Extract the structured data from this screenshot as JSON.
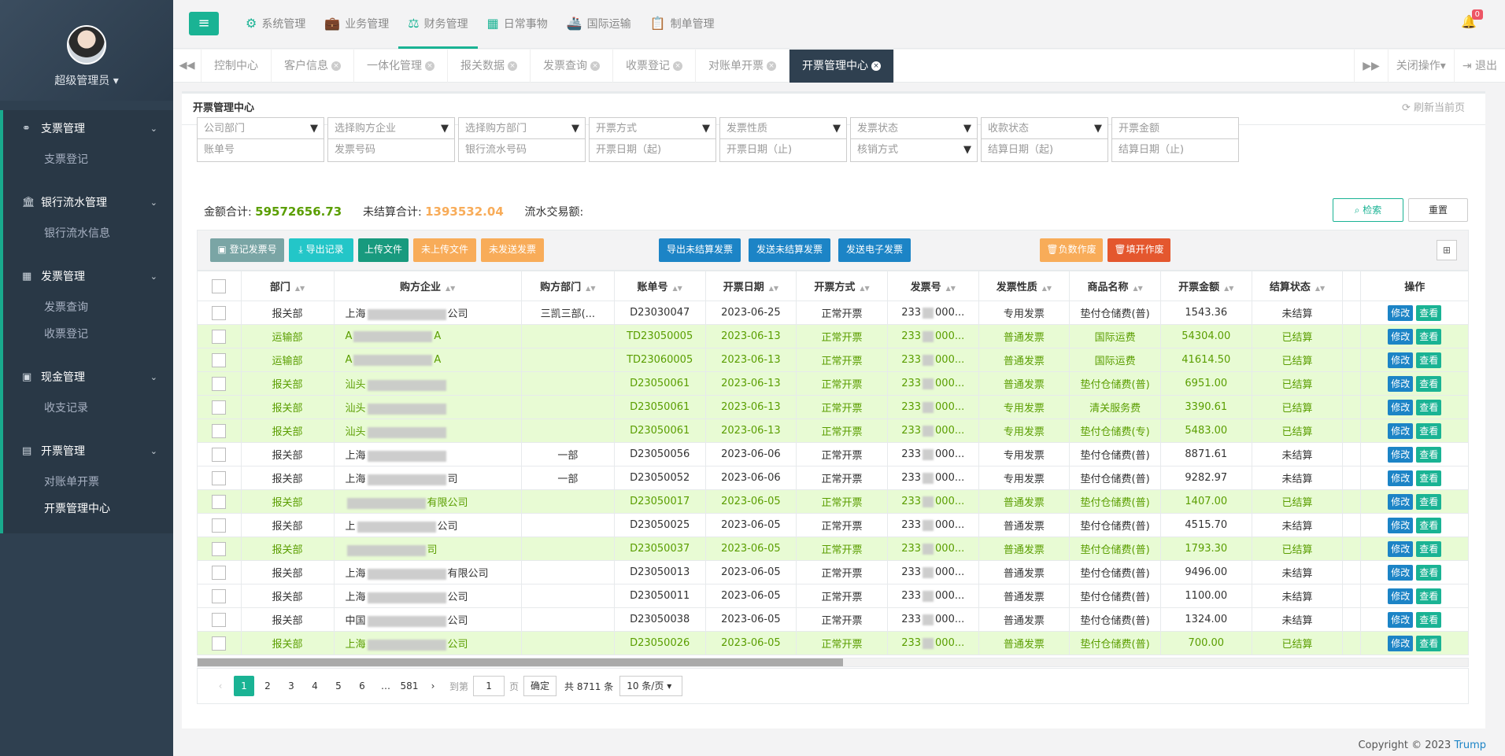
{
  "sidebar": {
    "user": "超级管理员",
    "groups": [
      {
        "label": "支票管理",
        "icon": "link-icon",
        "items": [
          "支票登记"
        ]
      },
      {
        "label": "银行流水管理",
        "icon": "bank-icon",
        "items": [
          "银行流水信息"
        ]
      },
      {
        "label": "发票管理",
        "icon": "grid-icon",
        "items": [
          "发票查询",
          "收票登记"
        ]
      },
      {
        "label": "现金管理",
        "icon": "money-icon",
        "items": [
          "收支记录"
        ]
      },
      {
        "label": "开票管理",
        "icon": "calendar-icon",
        "items": [
          "对账单开票",
          "开票管理中心"
        ]
      }
    ]
  },
  "topnav": [
    "系统管理",
    "业务管理",
    "财务管理",
    "日常事物",
    "国际运输",
    "制单管理"
  ],
  "topnav_active": "财务管理",
  "notification_count": "0",
  "tabs": [
    "控制中心",
    "客户信息",
    "一体化管理",
    "报关数据",
    "发票查询",
    "收票登记",
    "对账单开票",
    "开票管理中心"
  ],
  "tabbar_right": {
    "close_ops": "关闭操作",
    "logout": "退出"
  },
  "panel": {
    "title": "开票管理中心",
    "refresh": "刷新当前页"
  },
  "filters_row1": [
    "公司部门",
    "选择购方企业",
    "选择购方部门",
    "开票方式",
    "发票性质",
    "发票状态",
    "收款状态",
    "开票金额"
  ],
  "filters_row2": [
    "账单号",
    "发票号码",
    "银行流水号码",
    "开票日期（起)",
    "开票日期（止)",
    "核销方式",
    "结算日期（起)",
    "结算日期（止)"
  ],
  "sums": {
    "total_label": "金额合计:",
    "total_value": "59572656.73",
    "unsettled_label": "未结算合计:",
    "unsettled_value": "1393532.04",
    "flow_label": "流水交易额:"
  },
  "search_btn": "检索",
  "reset_btn": "重置",
  "toolbar": {
    "register": "登记发票号",
    "export_record": "导出记录",
    "upload": "上传文件",
    "not_uploaded": "未上传文件",
    "not_sent": "未发送发票",
    "export_unsettled": "导出未结算发票",
    "send_unsettled": "发送未结算发票",
    "send_e": "发送电子发票",
    "negative_void": "负数作废",
    "issue_void": "填开作废"
  },
  "columns": [
    "部门",
    "购方企业",
    "购方部门",
    "账单号",
    "开票日期",
    "开票方式",
    "发票号",
    "发票性质",
    "商品名称",
    "开票金额",
    "结算状态",
    "操作"
  ],
  "rows": [
    {
      "dept": "报关部",
      "company": "上海",
      "company_tail": "公司",
      "buyer_dept": "三凯三部(...",
      "bill": "D23030047",
      "date": "2023-06-25",
      "method": "正常开票",
      "invoice": "233",
      "invoice_tail": "000...",
      "nature": "专用发票",
      "goods": "垫付仓储费(普)",
      "amount": "1543.36",
      "status": "未结算"
    },
    {
      "dept": "运输部",
      "company": "A",
      "company_tail": "A",
      "buyer_dept": "",
      "bill": "TD23050005",
      "date": "2023-06-13",
      "method": "正常开票",
      "invoice": "233",
      "invoice_tail": "000...",
      "nature": "普通发票",
      "goods": "国际运费",
      "amount": "54304.00",
      "status": "已结算"
    },
    {
      "dept": "运输部",
      "company": "A",
      "company_tail": "A",
      "buyer_dept": "",
      "bill": "TD23060005",
      "date": "2023-06-13",
      "method": "正常开票",
      "invoice": "233",
      "invoice_tail": "000...",
      "nature": "普通发票",
      "goods": "国际运费",
      "amount": "41614.50",
      "status": "已结算"
    },
    {
      "dept": "报关部",
      "company": "汕头",
      "company_tail": "",
      "buyer_dept": "",
      "bill": "D23050061",
      "date": "2023-06-13",
      "method": "正常开票",
      "invoice": "233",
      "invoice_tail": "000...",
      "nature": "普通发票",
      "goods": "垫付仓储费(普)",
      "amount": "6951.00",
      "status": "已结算"
    },
    {
      "dept": "报关部",
      "company": "汕头",
      "company_tail": "",
      "buyer_dept": "",
      "bill": "D23050061",
      "date": "2023-06-13",
      "method": "正常开票",
      "invoice": "233",
      "invoice_tail": "000...",
      "nature": "专用发票",
      "goods": "清关服务费",
      "amount": "3390.61",
      "status": "已结算"
    },
    {
      "dept": "报关部",
      "company": "汕头",
      "company_tail": "",
      "buyer_dept": "",
      "bill": "D23050061",
      "date": "2023-06-13",
      "method": "正常开票",
      "invoice": "233",
      "invoice_tail": "000...",
      "nature": "专用发票",
      "goods": "垫付仓储费(专)",
      "amount": "5483.00",
      "status": "已结算"
    },
    {
      "dept": "报关部",
      "company": "上海",
      "company_tail": "",
      "buyer_dept": "一部",
      "bill": "D23050056",
      "date": "2023-06-06",
      "method": "正常开票",
      "invoice": "233",
      "invoice_tail": "000...",
      "nature": "专用发票",
      "goods": "垫付仓储费(普)",
      "amount": "8871.61",
      "status": "未结算"
    },
    {
      "dept": "报关部",
      "company": "上海",
      "company_tail": "司",
      "buyer_dept": "一部",
      "bill": "D23050052",
      "date": "2023-06-06",
      "method": "正常开票",
      "invoice": "233",
      "invoice_tail": "000...",
      "nature": "专用发票",
      "goods": "垫付仓储费(普)",
      "amount": "9282.97",
      "status": "未结算"
    },
    {
      "dept": "报关部",
      "company": "",
      "company_tail": "有限公司",
      "buyer_dept": "",
      "bill": "D23050017",
      "date": "2023-06-05",
      "method": "正常开票",
      "invoice": "233",
      "invoice_tail": "000...",
      "nature": "普通发票",
      "goods": "垫付仓储费(普)",
      "amount": "1407.00",
      "status": "已结算"
    },
    {
      "dept": "报关部",
      "company": "上",
      "company_tail": "公司",
      "buyer_dept": "",
      "bill": "D23050025",
      "date": "2023-06-05",
      "method": "正常开票",
      "invoice": "233",
      "invoice_tail": "000...",
      "nature": "普通发票",
      "goods": "垫付仓储费(普)",
      "amount": "4515.70",
      "status": "未结算"
    },
    {
      "dept": "报关部",
      "company": "",
      "company_tail": "司",
      "buyer_dept": "",
      "bill": "D23050037",
      "date": "2023-06-05",
      "method": "正常开票",
      "invoice": "233",
      "invoice_tail": "000...",
      "nature": "普通发票",
      "goods": "垫付仓储费(普)",
      "amount": "1793.30",
      "status": "已结算"
    },
    {
      "dept": "报关部",
      "company": "上海",
      "company_tail": "有限公司",
      "buyer_dept": "",
      "bill": "D23050013",
      "date": "2023-06-05",
      "method": "正常开票",
      "invoice": "233",
      "invoice_tail": "000...",
      "nature": "普通发票",
      "goods": "垫付仓储费(普)",
      "amount": "9496.00",
      "status": "未结算"
    },
    {
      "dept": "报关部",
      "company": "上海",
      "company_tail": "公司",
      "buyer_dept": "",
      "bill": "D23050011",
      "date": "2023-06-05",
      "method": "正常开票",
      "invoice": "233",
      "invoice_tail": "000...",
      "nature": "普通发票",
      "goods": "垫付仓储费(普)",
      "amount": "1100.00",
      "status": "未结算"
    },
    {
      "dept": "报关部",
      "company": "中国",
      "company_tail": "公司",
      "buyer_dept": "",
      "bill": "D23050038",
      "date": "2023-06-05",
      "method": "正常开票",
      "invoice": "233",
      "invoice_tail": "000...",
      "nature": "普通发票",
      "goods": "垫付仓储费(普)",
      "amount": "1324.00",
      "status": "未结算"
    },
    {
      "dept": "报关部",
      "company": "上海",
      "company_tail": "公司",
      "buyer_dept": "",
      "bill": "D23050026",
      "date": "2023-06-05",
      "method": "正常开票",
      "invoice": "233",
      "invoice_tail": "000...",
      "nature": "普通发票",
      "goods": "垫付仓储费(普)",
      "amount": "700.00",
      "status": "已结算"
    }
  ],
  "actions": {
    "edit": "修改",
    "view": "查看"
  },
  "pager": {
    "pages": [
      "1",
      "2",
      "3",
      "4",
      "5",
      "6",
      "…",
      "581"
    ],
    "goto_label": "到第",
    "page_value": "1",
    "page_unit": "页",
    "confirm": "确定",
    "total": "共 8711 条",
    "per_page": "10 条/页"
  },
  "copyright": {
    "text": "Copyright © 2023",
    "brand": "Trump"
  },
  "colors": {
    "accent": "#1ab394",
    "sidebar": "#2f4050",
    "settled_row": "#e8fbd4",
    "settled_text": "#5a9e00",
    "unsettled_amount": "#f8ac59"
  }
}
